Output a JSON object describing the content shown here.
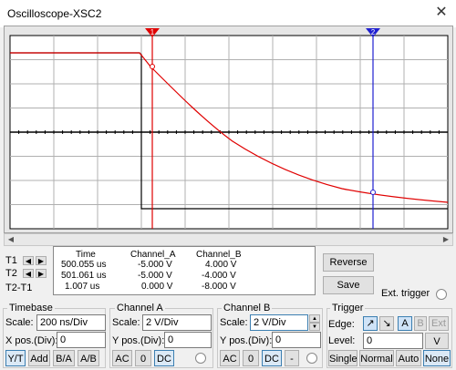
{
  "window": {
    "title": "Oscilloscope-XSC2",
    "close_glyph": "✕"
  },
  "plot": {
    "grid_divisions": {
      "x": 10,
      "y": 8
    },
    "background": "#ffffff",
    "channel_a_color": "#e00000",
    "channel_b_color": "#000000",
    "cursor_t1_color": "#e00000",
    "cursor_t2_color": "#2020d0",
    "cursor_t1_label": "1",
    "cursor_t2_label": "2"
  },
  "cursors": {
    "t1_label": "T1",
    "t2_label": "T2",
    "diff_label": "T2-T1",
    "headers": {
      "time": "Time",
      "a": "Channel_A",
      "b": "Channel_B"
    },
    "rows": [
      {
        "time": "500.055 us",
        "a": "-5.000 V",
        "b": "4.000 V"
      },
      {
        "time": "501.061 us",
        "a": "-5.000 V",
        "b": "-4.000 V"
      },
      {
        "time": "1.007 us",
        "a": "0.000 V",
        "b": "-8.000 V"
      }
    ]
  },
  "buttons": {
    "reverse": "Reverse",
    "save": "Save",
    "ext_trigger": "Ext. trigger"
  },
  "timebase": {
    "title": "Timebase",
    "scale_label": "Scale:",
    "scale_value": "200 ns/Div",
    "xpos_label": "X pos.(Div):",
    "xpos_value": "0",
    "modes": [
      "Y/T",
      "Add",
      "B/A",
      "A/B"
    ]
  },
  "channel_a": {
    "title": "Channel A",
    "scale_label": "Scale:",
    "scale_value": "2  V/Div",
    "ypos_label": "Y pos.(Div):",
    "ypos_value": "0",
    "couplings": [
      "AC",
      "0",
      "DC"
    ]
  },
  "channel_b": {
    "title": "Channel B",
    "scale_label": "Scale:",
    "scale_value": "2  V/Div",
    "ypos_label": "Y pos.(Div):",
    "ypos_value": "0",
    "couplings": [
      "AC",
      "0",
      "DC",
      "-"
    ]
  },
  "trigger": {
    "title": "Trigger",
    "edge_label": "Edge:",
    "edge_rise": "↗",
    "edge_fall": "↘",
    "sources": [
      "A",
      "B",
      "Ext"
    ],
    "level_label": "Level:",
    "level_value": "0",
    "level_unit": "V",
    "modes": [
      "Single",
      "Normal",
      "Auto",
      "None"
    ]
  }
}
